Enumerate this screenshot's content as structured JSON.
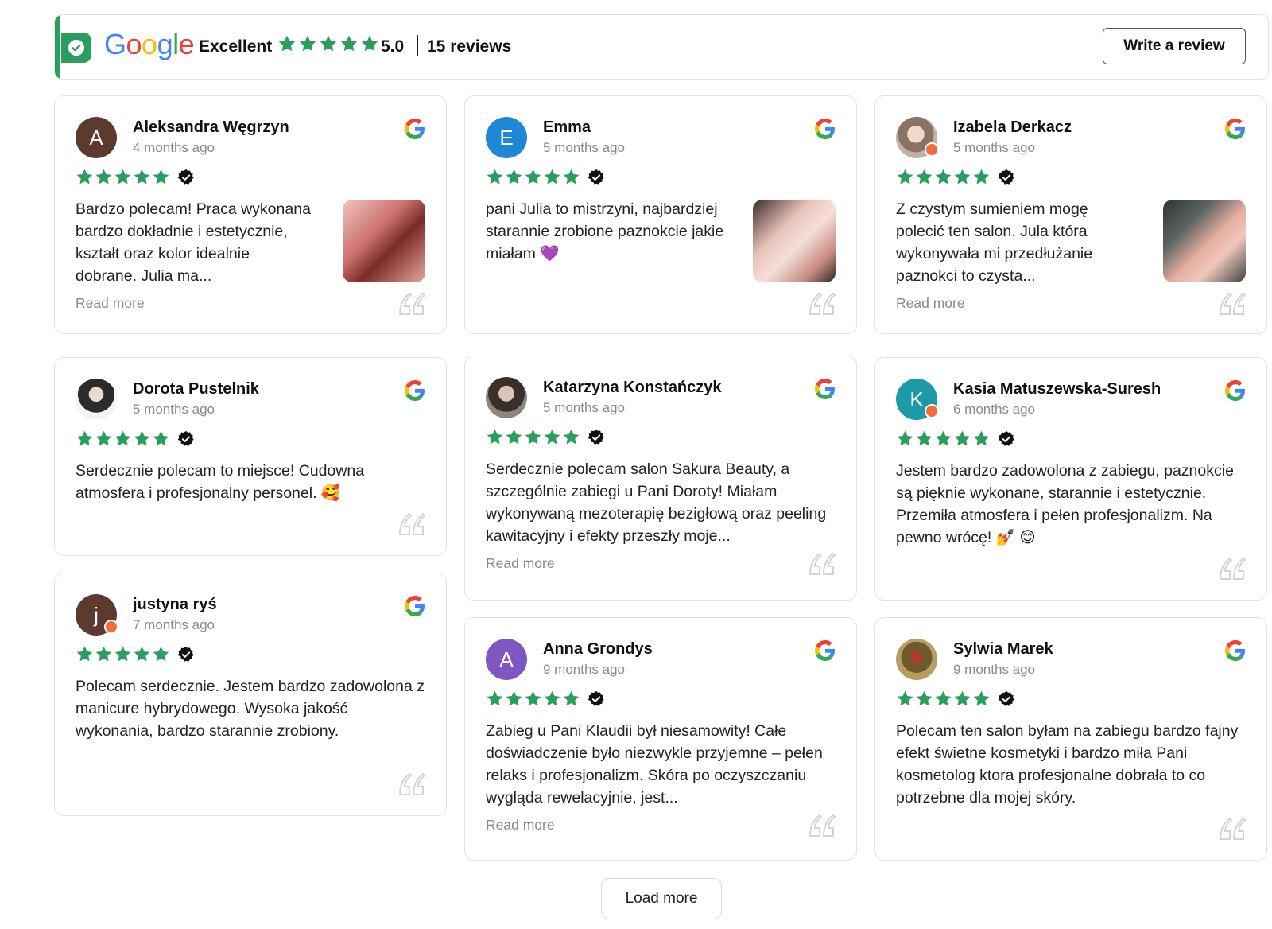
{
  "header": {
    "google_letters": [
      {
        "ch": "G",
        "color": "#4285F4"
      },
      {
        "ch": "o",
        "color": "#EA4335"
      },
      {
        "ch": "o",
        "color": "#FBBC05"
      },
      {
        "ch": "g",
        "color": "#4285F4"
      },
      {
        "ch": "l",
        "color": "#34A853"
      },
      {
        "ch": "e",
        "color": "#EA4335"
      }
    ],
    "rating_label": "Excellent",
    "score": "5.0",
    "review_count": "15 reviews",
    "write_review_label": "Write a review",
    "accent_color": "#2a9d5f",
    "star_color": "#2a9d5f"
  },
  "reviews": [
    {
      "name": "Aleksandra Węgrzyn",
      "date": "4 months ago",
      "avatar_letter": "A",
      "avatar_color": "#5d3a2e",
      "rating": 5,
      "text": "Bardzo polecam! Praca wykonana bardzo dokładnie i estetycznie, kształt oraz kolor idealnie dobrane. Julia ma...",
      "read_more": "Read more"
    },
    {
      "name": "Emma",
      "date": "5 months ago",
      "avatar_letter": "E",
      "avatar_color": "#1e88d4",
      "rating": 5,
      "text": "pani Julia to mistrzyni, najbardziej starannie zrobione paznokcie jakie miałam 💜"
    },
    {
      "name": "Izabela Derkacz",
      "date": "5 months ago",
      "avatar_letter": "",
      "rating": 5,
      "text": "Z czystym sumieniem mogę polecić ten salon. Jula która wykonywała mi przedłużanie paznokci to czysta...",
      "read_more": "Read more"
    },
    {
      "name": "Dorota Pustelnik",
      "date": "5 months ago",
      "avatar_letter": "",
      "rating": 5,
      "text": "Serdecznie polecam to miejsce! Cudowna atmosfera i profesjonalny personel. 🥰"
    },
    {
      "name": "Katarzyna Konstańczyk",
      "date": "5 months ago",
      "avatar_letter": "",
      "rating": 5,
      "text": "Serdecznie polecam salon Sakura Beauty, a szczególnie zabiegi u Pani Doroty! Miałam wykonywaną mezoterapię bezigłową oraz peeling kawitacyjny i efekty przeszły moje...",
      "read_more": "Read more"
    },
    {
      "name": "Kasia Matuszewska-Suresh",
      "date": "6 months ago",
      "avatar_letter": "K",
      "avatar_color": "#1d9aa8",
      "rating": 5,
      "text": "Jestem bardzo zadowolona z zabiegu, paznokcie są pięknie wykonane, starannie i estetycznie. Przemiła atmosfera i pełen profesjonalizm. Na pewno wrócę! 💅 😊"
    },
    {
      "name": "justyna ryś",
      "date": "7 months ago",
      "avatar_letter": "j",
      "avatar_color": "#5d3a2e",
      "rating": 5,
      "text": "Polecam serdecznie. Jestem bardzo zadowolona z manicure hybrydowego. Wysoka jakość wykonania, bardzo starannie zrobiony."
    },
    {
      "name": "Anna Grondys",
      "date": "9 months ago",
      "avatar_letter": "A",
      "avatar_color": "#7e57c2",
      "rating": 5,
      "text": "Zabieg u Pani Klaudii był niesamowity! Całe doświadczenie było niezwykle przyjemne – pełen relaks i profesjonalizm. Skóra po oczyszczaniu wygląda rewelacyjnie, jest...",
      "read_more": "Read more"
    },
    {
      "name": "Sylwia Marek",
      "date": "9 months ago",
      "avatar_letter": "",
      "rating": 5,
      "text": "Polecam ten salon byłam na zabiegu bardzo fajny efekt świetne kosmetyki i bardzo miła Pani kosmetolog ktora profesjonalne dobrała to co potrzebne dla mojej skóry."
    }
  ],
  "load_more_label": "Load more"
}
